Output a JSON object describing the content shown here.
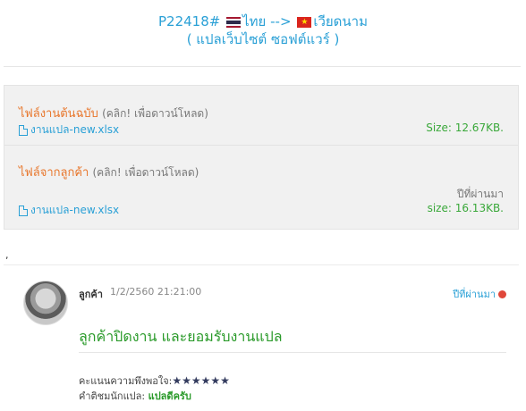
{
  "header": {
    "job_id": "P22418#",
    "source_lang": "ไทย",
    "arrow": "-->",
    "target_lang": "เวียดนาม",
    "subtitle": "( แปลเว็บไซต์ ซอฟต์แวร์ )"
  },
  "files": {
    "original": {
      "title": "ไฟล์งานต้นฉบับ",
      "hint": "(คลิก! เพื่อดาวน์โหลด)",
      "filename": "งานแปล-new.xlsx",
      "size": "Size: 12.67KB."
    },
    "customer": {
      "title": "ไฟล์จากลูกค้า",
      "hint": "(คลิก! เพื่อดาวน์โหลด)",
      "filename": "งานแปล-new.xlsx",
      "posted": "ปีที่ผ่านมา",
      "size": "size: 16.13KB."
    }
  },
  "stray_char": ",",
  "comment": {
    "author": "ลูกค้า",
    "date": "1/2/2560 21:21:00",
    "since": "ปีที่ผ่านมา",
    "status": "ลูกค้าปิดงาน และยอมรับงานแปล",
    "rating_label": "คะแนนความพึงพอใจ:",
    "stars": "★★★★★★",
    "review_label": "คำติชมนักแปล:",
    "review_text": "แปลดีครับ"
  },
  "colors": {
    "accent": "#2aa0d6",
    "orange": "#e8762b",
    "green": "#3aa83a"
  }
}
